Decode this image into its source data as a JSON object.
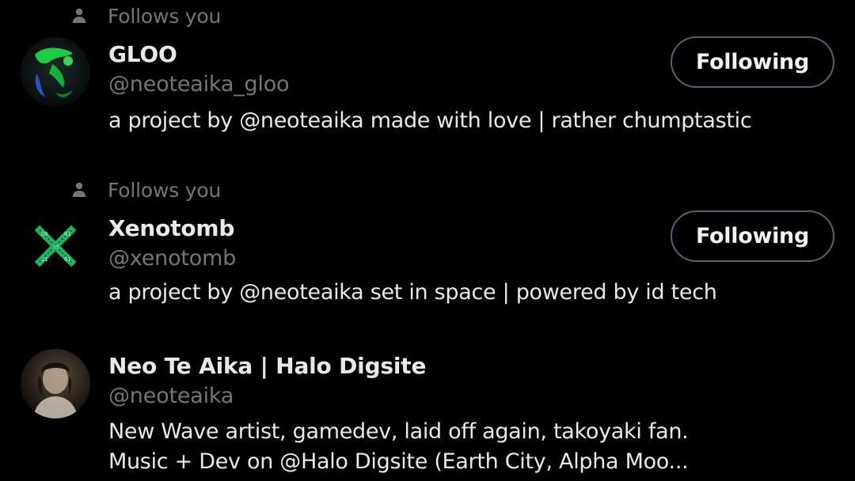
{
  "users": [
    {
      "social_context": "Follows you",
      "display_name": "GLOO",
      "handle": "@neoteaika_gloo",
      "bio_lines": [
        "a project by @neoteaika made with love | rather chumptastic"
      ],
      "follow_button": "Following",
      "avatar_icon": "gloo-avatar"
    },
    {
      "social_context": "Follows you",
      "display_name": "Xenotomb",
      "handle": "@xenotomb",
      "bio_lines": [
        "a project by @neoteaika set in space | powered by id tech"
      ],
      "follow_button": "Following",
      "avatar_icon": "xenotomb-avatar"
    },
    {
      "display_name": "Neo Te Aika | Halo Digsite",
      "handle": "@neoteaika",
      "bio_lines": [
        "New Wave artist, gamedev, laid off again, takoyaki fan.",
        "Music + Dev on @Halo Digsite (Earth City, Alpha Moo..."
      ],
      "avatar_icon": "neoteaika-avatar"
    }
  ],
  "colors": {
    "background": "#000000",
    "primary_text": "#e7e9ea",
    "secondary_text": "#71767b",
    "button_border": "#536471"
  }
}
